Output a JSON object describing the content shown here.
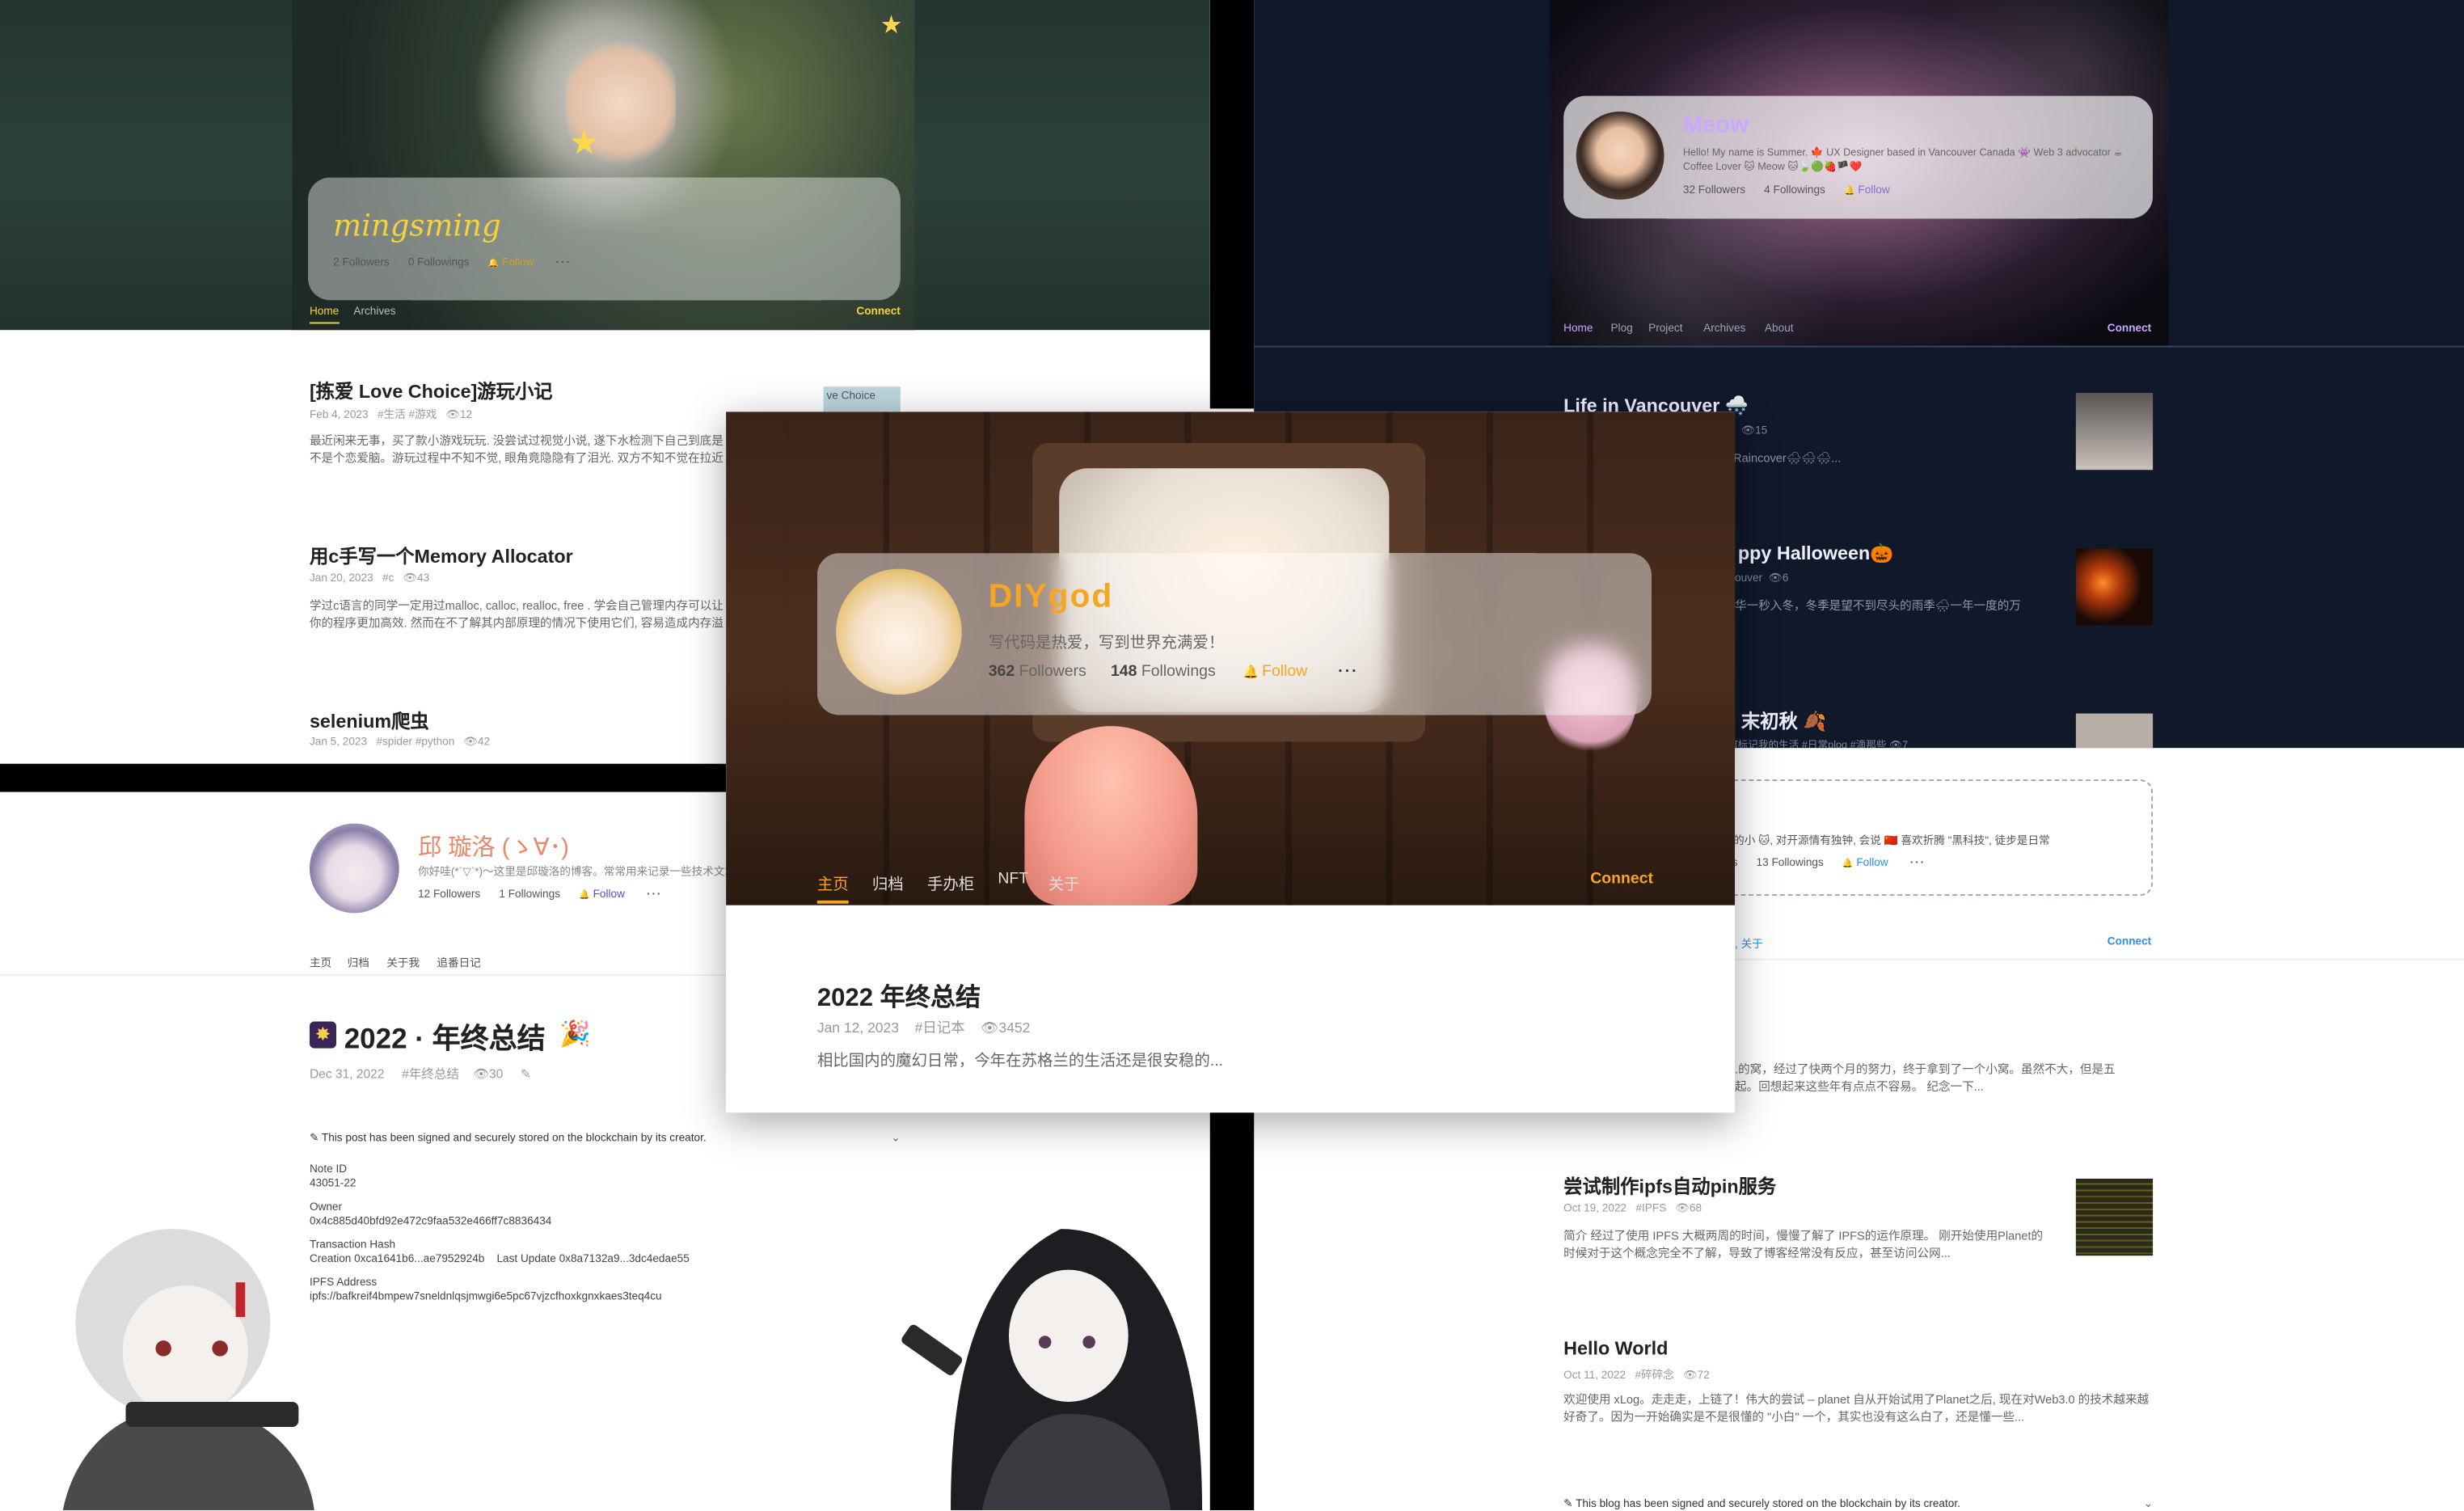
{
  "mingsming": {
    "name": "mingsming",
    "followers": "2 Followers",
    "followings": "0 Followings",
    "follow": "Follow",
    "more": "···",
    "nav": [
      "Home",
      "Archives"
    ],
    "connect": "Connect",
    "posts": [
      {
        "title": "[拣爱 Love Choice]游玩小记",
        "date": "Feb 4, 2023",
        "tags": "#生活 #游戏",
        "views": "12",
        "excerpt": "最近闲来无事，买了款小游戏玩玩. 没尝试过视觉小说, 遂下水检测下自己到底是不是个恋爱脑。游玩过程中不知不觉, 眼角竟隐隐有了泪光. 双方不知不觉在拉近距离，更深…",
        "thumb_text": "ve Choice"
      },
      {
        "title": "用c手写一个Memory Allocator",
        "date": "Jan 20, 2023",
        "tags": "#c",
        "views": "43",
        "excerpt": "学过c语言的同学一定用过malloc, calloc, realloc, free . 学会自己管理内存可以让你的程序更加高效. 然而在不了解其内部原理的情况下使用它们, 容易造成内存溢出, 野指针等问题…"
      },
      {
        "title": "selenium爬虫",
        "date": "Jan 5, 2023",
        "tags": "#spider #python",
        "views": "42"
      }
    ]
  },
  "meow": {
    "name": "Meow",
    "bio": "Hello! My name is Summer. 🍁 UX Designer based in Vancouver Canada 👾 Web 3 advocator ☕ Coffee Lover 🐱 Meow 🐱🍃🟢🍓🏴❤️",
    "followers": "32 Followers",
    "followings": "4 Followings",
    "follow": "Follow",
    "nav": [
      "Home",
      "Plog",
      "Project",
      "Archives",
      "About"
    ],
    "connect": "Connect",
    "posts": [
      {
        "title": "Life in Vancouver 🌨️",
        "views": "15",
        "excerpt": "Raincover🌨🌨🌨..."
      },
      {
        "title": "ppy Halloween🎃",
        "meta": "ouver",
        "views": "6",
        "excerpt": "华一秒入冬，冬季是望不到尽头的雨季🌧一年一度的万"
      },
      {
        "title": "末初秋 🍂",
        "meta": "[标记我的生活 #日常plog #滴那些",
        "views": "7"
      }
    ]
  },
  "diygod": {
    "name": "DIYgod",
    "bio": "写代码是热爱，写到世界充满爱！",
    "followers_n": "362",
    "followers_l": "Followers",
    "followings_n": "148",
    "followings_l": "Followings",
    "follow": "Follow",
    "more": "···",
    "nav": [
      "主页",
      "归档",
      "手办柜",
      "NFT",
      "关于"
    ],
    "connect": "Connect",
    "post": {
      "title": "2022 年终总结",
      "date": "Jan 12, 2023",
      "tag": "#日记本",
      "views": "3452",
      "excerpt": "相比国内的魔幻日常，今年在苏格兰的生活还是很安稳的..."
    }
  },
  "qiu": {
    "name": "邱 璇洛 (ゝ∀･)",
    "bio": "你好哇(*´▽`*)～这里是邱璇洛的博客。常常用来记录一些技术文章和小日常~",
    "followers": "12 Followers",
    "followings": "1 Followings",
    "follow": "Follow",
    "more": "···",
    "nav": [
      "主页",
      "归档",
      "关于我",
      "追番日记"
    ],
    "post": {
      "title": "2022 · 年终总结",
      "date": "Dec 31, 2022",
      "tag": "#年终总结",
      "views": "30"
    },
    "chain_note": "This post has been signed and securely stored on the blockchain by its creator.",
    "fields": [
      {
        "label": "Note ID",
        "value": "43051-22"
      },
      {
        "label": "Owner",
        "value": "0x4c885d40bfd92e472c9faa532e466ff7c8836434"
      },
      {
        "label": "Transaction Hash",
        "value": "Creation 0xca1641b6...ae7952924b    Last Update 0x8a7132a9...3dc4edae55"
      },
      {
        "label": "IPFS Address",
        "value": "ipfs://bafkreif4bmpew7sneldnlqsjmwgi6e5pc67vjzcfhoxkgnxkaes3teq4cu"
      }
    ]
  },
  "right": {
    "bio_frag": "态的小 🐱, 对开源情有独钟, 会说 🇨🇳 喜欢折腾 \"黑科技\", 徒步是日常",
    "followers_frag": "ers",
    "followings": "13 Followings",
    "follow": "Follow",
    "more": "···",
    "nav_frag": ", 关于",
    "connect": "Connect",
    "map_excerpt": ".的窝，经过了快两个月的努力，终于拿到了一个小窝。虽然不大，但是五\n起。回想起来这些年有点点不容易。 纪念一下...",
    "posts": [
      {
        "title": "尝试制作ipfs自动pin服务",
        "date": "Oct 19, 2022",
        "tag": "#IPFS",
        "views": "68",
        "excerpt": "简介 经过了使用 IPFS 大概两周的时间，慢慢了解了 IPFS的运作原理。 刚开始使用Planet的时候对于这个概念完全不了解，导致了博客经常没有反应，甚至访问公网..."
      },
      {
        "title": "Hello World",
        "date": "Oct 11, 2022",
        "tag": "#碎碎念",
        "views": "72",
        "excerpt": "欢迎使用 xLog。走走走，上链了！伟大的尝试 – planet 自从开始试用了Planet之后, 现在对Web3.0 的技术越来越好奇了。因为一开始确实是不是很懂的 \"小白\" 一个，其实也没有这么白了，还是懂一些..."
      }
    ],
    "chain_note": "This blog has been signed and securely stored on the blockchain by its creator."
  },
  "colors": {
    "diygod_accent": "#f5a623",
    "meow_accent": "#c9a8ff",
    "qiu_name": "#e8886a",
    "mingsming_name": "#f5d23b",
    "right_follow": "#2f8fe8"
  }
}
